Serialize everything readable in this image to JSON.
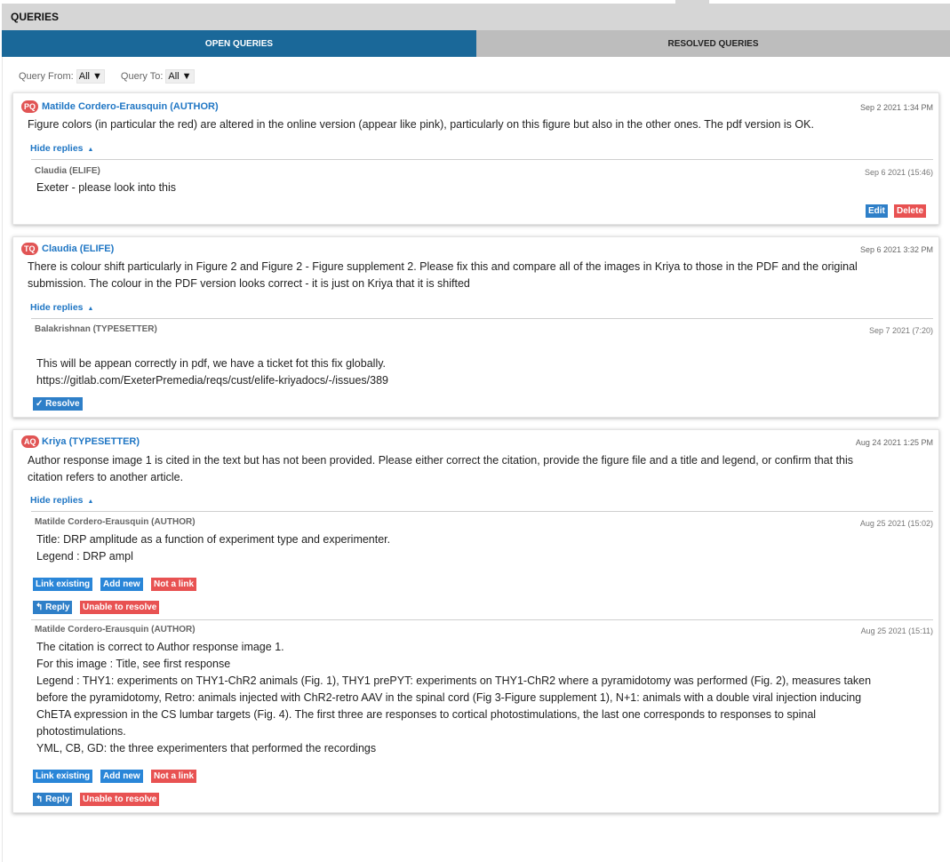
{
  "panel": {
    "title": "QUERIES"
  },
  "tabs": [
    {
      "label": "OPEN QUERIES",
      "active": true
    },
    {
      "label": "RESOLVED QUERIES",
      "active": false
    }
  ],
  "filters": {
    "from_label": "Query From:",
    "from_value": "All ▼",
    "to_label": "Query To:",
    "to_value": "All ▼"
  },
  "colors": {
    "accent": "#1a6899",
    "link": "#1f76c4",
    "danger": "#e85252",
    "header_bg": "#d6d6d6",
    "tab_inactive": "#bdbdbd"
  },
  "queries": [
    {
      "badge": "PQ",
      "author": "Matilde Cordero-Erausquin (AUTHOR)",
      "date": "Sep 2 2021 1:34 PM",
      "text": "Figure colors (in particular the red) are altered in the online version (appear like pink), particularly on this figure but also in the other ones. The pdf version is OK.",
      "hide_label": "Hide replies",
      "replies": [
        {
          "author": "Claudia (ELIFE)",
          "date": "Sep 6 2021 (15:46)",
          "lines": [
            "Exeter - please look into this"
          ],
          "edit_label": "Edit",
          "delete_label": "Delete"
        }
      ]
    },
    {
      "badge": "TQ",
      "author": "Claudia (ELIFE)",
      "date": "Sep 6 2021 3:32 PM",
      "text_lines": [
        "There is colour shift particularly in Figure 2 and Figure 2 - Figure supplement 2. Please fix this and compare all of the images in Kriya to those in the PDF and the original",
        "submission. The colour in the PDF version looks correct - it is just on Kriya that it is shifted"
      ],
      "hide_label": "Hide replies",
      "replies": [
        {
          "author": "Balakrishnan (TYPESETTER)",
          "date": "Sep 7 2021 (7:20)",
          "lines": [
            "This will be appean correctly in pdf, we have a ticket fot this fix globally.",
            "https://gitlab.com/ExeterPremedia/reqs/cust/elife-kriyadocs/-/issues/389"
          ],
          "resolve_label": "✓ Resolve"
        }
      ]
    },
    {
      "badge": "AQ",
      "author": "Kriya (TYPESETTER)",
      "date": "Aug 24 2021 1:25 PM",
      "text_lines": [
        "Author response image 1 is cited in the text but has not been provided. Please either correct the citation, provide the figure file and a title and legend, or confirm that this",
        "citation refers to another article."
      ],
      "hide_label": "Hide replies",
      "replies": [
        {
          "author": "Matilde Cordero-Erausquin (AUTHOR)",
          "date": "Aug 25 2021 (15:02)",
          "lines": [
            "Title: DRP amplitude as a function of experiment type and experimenter.",
            "Legend : DRP ampl"
          ],
          "link_existing": "Link existing",
          "add_new": "Add new",
          "not_a_link": "Not a link",
          "reply": "↰ Reply",
          "unable": "Unable to resolve"
        },
        {
          "author": "Matilde Cordero-Erausquin (AUTHOR)",
          "date": "Aug 25 2021 (15:11)",
          "lines": [
            "The citation is correct to Author response image 1.",
            "For this image : Title, see first response",
            "Legend : THY1: experiments on THY1-ChR2 animals (Fig. 1), THY1 prePYT: experiments on THY1-ChR2 where a pyramidotomy was performed (Fig. 2), measures taken",
            "before the pyramidotomy, Retro: animals injected with ChR2-retro AAV in the spinal cord (Fig 3-Figure supplement 1), N+1: animals with a double viral injection inducing",
            "ChETA expression in the CS lumbar targets (Fig. 4). The first three are responses to cortical photostimulations, the last one corresponds to responses to spinal",
            "photostimulations.",
            "YML, CB, GD: the three experimenters that performed the recordings"
          ],
          "link_existing": "Link existing",
          "add_new": "Add new",
          "not_a_link": "Not a link",
          "reply": "↰ Reply",
          "unable": "Unable to resolve"
        }
      ]
    }
  ]
}
